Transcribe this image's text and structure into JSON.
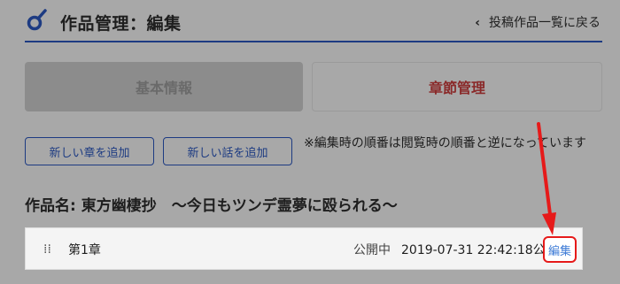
{
  "header": {
    "title": "作品管理：編集",
    "back_chevron": "‹",
    "back_label": "投稿作品一覧に戻る"
  },
  "tabs": {
    "basic": "基本情報",
    "chapters": "章節管理"
  },
  "actions": {
    "add_chapter": "新しい章を追加",
    "add_story": "新しい話を追加",
    "note": "※編集時の順番は閲覧時の順番と逆になっています"
  },
  "work": {
    "label": "作品名: 東方幽棲抄　～今日もツンデ霊夢に殴られる～"
  },
  "chapter_rows": [
    {
      "drag_handle": "⁞⁞",
      "name": "第1章",
      "status": "公開中",
      "published": "2019-07-31 22:42:18公開",
      "edit": "編集"
    }
  ],
  "colors": {
    "overlay_bg": "#a8a8a8",
    "accent_blue": "#1d3b82",
    "highlight_red": "#e61a1a",
    "edit_link": "#3c7ad6"
  }
}
